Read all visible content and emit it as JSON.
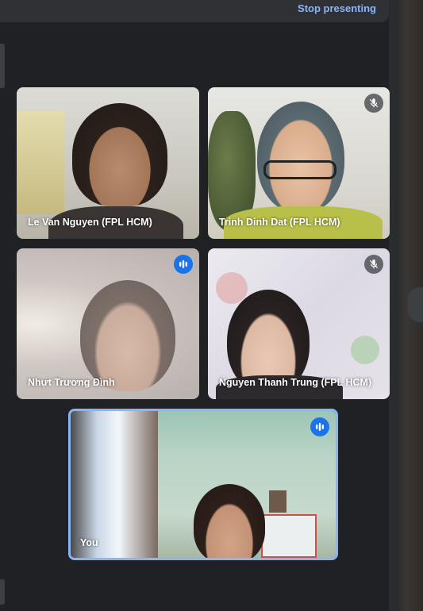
{
  "banner": {
    "stop_label": "Stop presenting"
  },
  "tiles": [
    {
      "name": "Le Van Nguyen (FPL HCM)",
      "audio": "none"
    },
    {
      "name": "Trinh Dinh Dat (FPL HCM)",
      "audio": "muted",
      "icon": "mic-off-icon"
    },
    {
      "name": "Nhựt Trương Đình",
      "audio": "speaking",
      "icon": "speaking-indicator-icon"
    },
    {
      "name": "Nguyen Thanh Trung (FPL HCM)",
      "audio": "muted",
      "icon": "mic-off-icon"
    },
    {
      "name": "You",
      "audio": "speaking",
      "icon": "speaking-indicator-icon"
    }
  ],
  "colors": {
    "accent": "#8ab4f8",
    "speaking": "#1a73e8",
    "background": "#202124"
  }
}
